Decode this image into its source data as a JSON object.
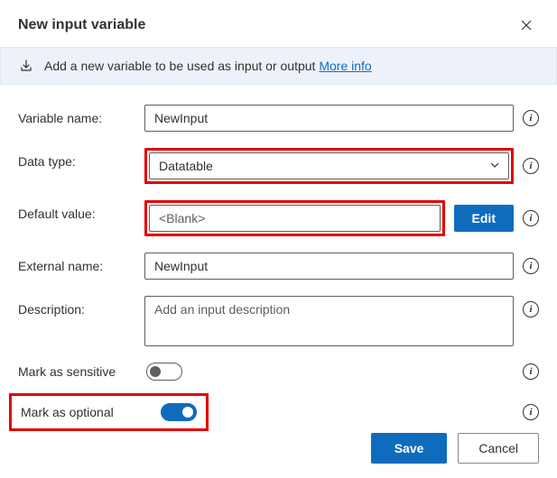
{
  "header": {
    "title": "New input variable"
  },
  "banner": {
    "text": "Add a new variable to be used as input or output",
    "link_label": "More info"
  },
  "fields": {
    "variable_name": {
      "label": "Variable name:",
      "value": "NewInput"
    },
    "data_type": {
      "label": "Data type:",
      "value": "Datatable"
    },
    "default_value": {
      "label": "Default value:",
      "value": "<Blank>",
      "edit_label": "Edit"
    },
    "external_name": {
      "label": "External name:",
      "value": "NewInput"
    },
    "description": {
      "label": "Description:",
      "placeholder": "Add an input description"
    },
    "mark_sensitive": {
      "label": "Mark as sensitive",
      "on": false
    },
    "mark_optional": {
      "label": "Mark as optional",
      "on": true
    }
  },
  "footer": {
    "save_label": "Save",
    "cancel_label": "Cancel"
  }
}
